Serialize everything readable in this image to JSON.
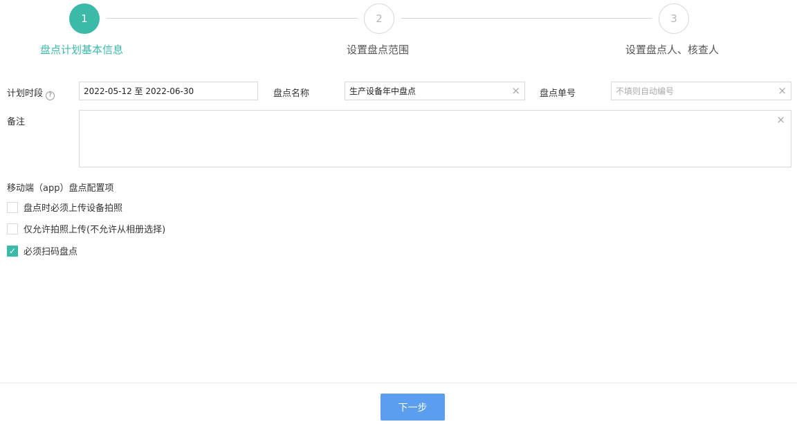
{
  "stepper": {
    "steps": [
      {
        "number": "1",
        "label": "盘点计划基本信息",
        "state": "active"
      },
      {
        "number": "2",
        "label": "设置盘点范围",
        "state": "inactive"
      },
      {
        "number": "3",
        "label": "设置盘点人、核查人",
        "state": "inactive"
      }
    ]
  },
  "form": {
    "plan_period": {
      "label": "计划时段",
      "help_icon": "?",
      "value": "2022-05-12 至 2022-06-30"
    },
    "inventory_name": {
      "label": "盘点名称",
      "value": "生产设备年中盘点",
      "clear_icon": "×"
    },
    "inventory_number": {
      "label": "盘点单号",
      "placeholder": "不填则自动编号",
      "clear_icon": "×"
    },
    "remarks": {
      "label": "备注",
      "value": "",
      "clear_icon": "×"
    }
  },
  "mobile_config": {
    "title": "移动端（app）盘点配置项",
    "options": [
      {
        "label": "盘点时必须上传设备拍照",
        "checked": false
      },
      {
        "label": "仅允许拍照上传(不允许从相册选择)",
        "checked": false
      },
      {
        "label": "必须扫码盘点",
        "checked": true,
        "check_mark": "✓"
      }
    ]
  },
  "footer": {
    "next_button": "下一步"
  },
  "colors": {
    "accent": "#3bbaaa",
    "primary_button": "#5b9ef0",
    "border": "#d9d9d9"
  }
}
